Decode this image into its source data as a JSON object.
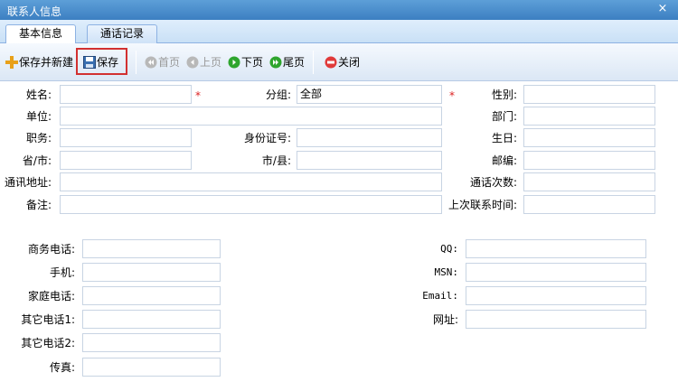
{
  "window": {
    "title": "联系人信息",
    "close_symbol": "×"
  },
  "tabs": [
    {
      "label": "基本信息",
      "active": true
    },
    {
      "label": "通话记录",
      "active": false
    }
  ],
  "toolbar": {
    "save_new": "保存并新建",
    "save": "保存",
    "first": "首页",
    "prev": "上页",
    "next": "下页",
    "last": "尾页",
    "close": "关闭"
  },
  "form": {
    "name_label": "姓名:",
    "name_value": "",
    "group_label": "分组:",
    "group_value": "全部",
    "gender_label": "性别:",
    "gender_value": "",
    "unit_label": "单位:",
    "unit_value": "",
    "dept_label": "部门:",
    "dept_value": "",
    "position_label": "职务:",
    "position_value": "",
    "idcard_label": "身份证号:",
    "idcard_value": "",
    "birthday_label": "生日:",
    "birthday_value": "",
    "province_label": "省/市:",
    "province_value": "",
    "city_label": "市/县:",
    "city_value": "",
    "zip_label": "邮编:",
    "zip_value": "",
    "address_label": "通讯地址:",
    "address_value": "",
    "calls_label": "通话次数:",
    "calls_value": "",
    "note_label": "备注:",
    "note_value": "",
    "lastcontact_label": "上次联系时间:",
    "lastcontact_value": "",
    "required_mark": "*"
  },
  "contact": {
    "biz_phone_label": "商务电话:",
    "mobile_label": "手机:",
    "home_phone_label": "家庭电话:",
    "other1_label": "其它电话1:",
    "other2_label": "其它电话2:",
    "fax_label": "传真:",
    "qq_label": "QQ:",
    "msn_label": "MSN:",
    "email_label": "Email:",
    "website_label": "网址:"
  },
  "colors": {
    "title_bar": "#3c7fc2",
    "required": "#d22222",
    "save_highlight": "#d23030",
    "field_border": "#c8d4e3"
  },
  "icons": {
    "save_new": "plus-icon",
    "save": "floppy-disk-icon",
    "first": "double-left-arrow-icon",
    "prev": "left-arrow-icon",
    "next": "right-arrow-icon",
    "last": "double-right-arrow-icon",
    "close": "no-entry-icon"
  }
}
